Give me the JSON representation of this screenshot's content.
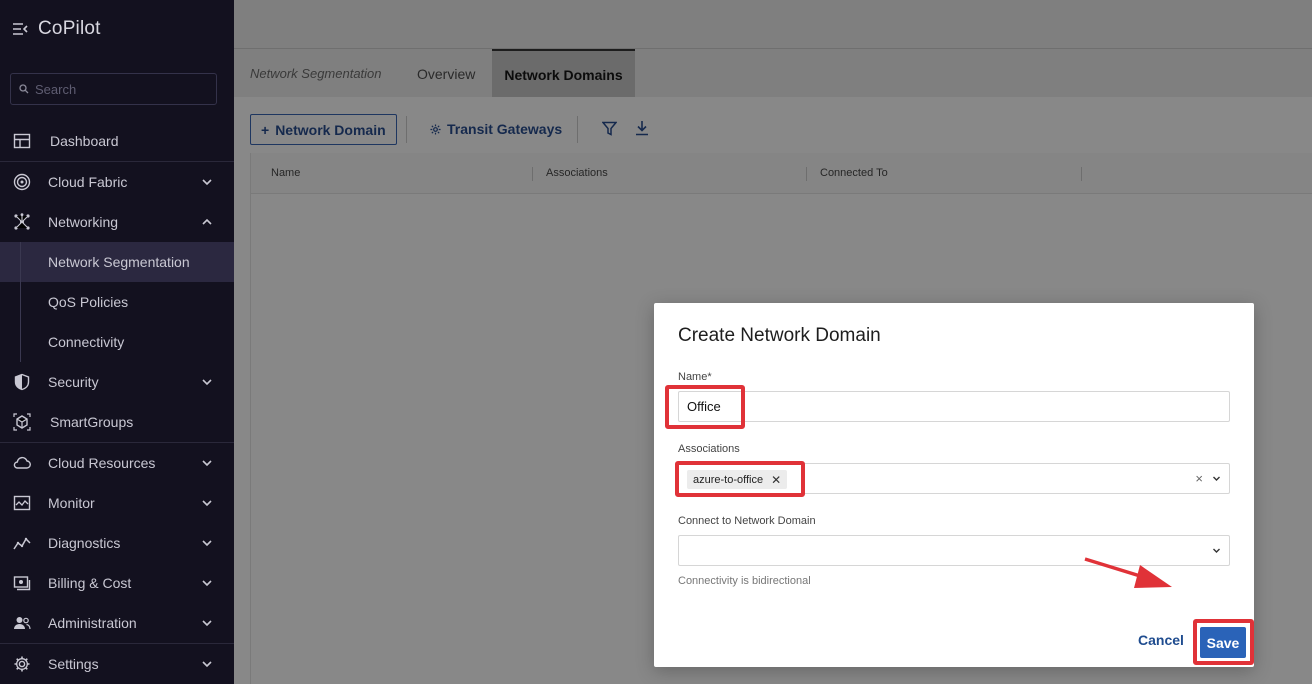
{
  "app": {
    "title": "CoPilot"
  },
  "search": {
    "placeholder": "Search"
  },
  "sidebar": {
    "items": [
      {
        "label": "Dashboard"
      },
      {
        "label": "Cloud Fabric"
      },
      {
        "label": "Networking"
      },
      {
        "label": "Network Segmentation"
      },
      {
        "label": "QoS Policies"
      },
      {
        "label": "Connectivity"
      },
      {
        "label": "Security"
      },
      {
        "label": "SmartGroups"
      },
      {
        "label": "Cloud Resources"
      },
      {
        "label": "Monitor"
      },
      {
        "label": "Diagnostics"
      },
      {
        "label": "Billing & Cost"
      },
      {
        "label": "Administration"
      },
      {
        "label": "Settings"
      }
    ]
  },
  "tabs": {
    "breadcrumb": "Network Segmentation",
    "overview": "Overview",
    "network_domains": "Network Domains"
  },
  "toolbar": {
    "add_domain_label": "Network Domain",
    "transit_gateways_label": "Transit Gateways"
  },
  "table": {
    "columns": [
      "Name",
      "Associations",
      "Connected To"
    ]
  },
  "modal": {
    "title": "Create Network Domain",
    "name_label": "Name",
    "name_required": "*",
    "name_value": "Office",
    "associations_label": "Associations",
    "association_chip": "azure-to-office",
    "connect_label": "Connect to Network Domain",
    "helper": "Connectivity is bidirectional",
    "cancel_label": "Cancel",
    "save_label": "Save"
  },
  "colors": {
    "sidebar_bg": "#13111f",
    "primary": "#2a63b8",
    "highlight": "#e03238"
  }
}
